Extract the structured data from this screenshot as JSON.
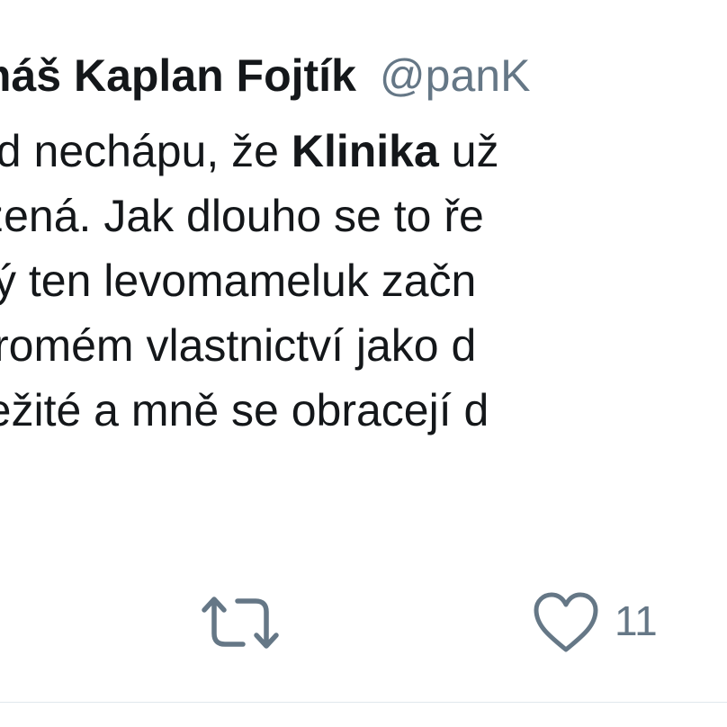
{
  "author": {
    "display_name": "máš Kaplan Fojtík",
    "handle": "@panK"
  },
  "tweet": {
    "line1_pre": "ád nechápu, že ",
    "line1_bold": "Klinika",
    "line1_post": " už",
    "line2": "izená. Jak dlouho se to ře",
    "line3": "ký ten levomameluk začn",
    "line4": "kromém vlastnictví jako d",
    "line5": "řežité a mně se obracejí d"
  },
  "actions": {
    "retweet_icon": "retweet-icon",
    "like_icon": "heart-icon",
    "like_count": "11",
    "icon_color": "#657786"
  }
}
